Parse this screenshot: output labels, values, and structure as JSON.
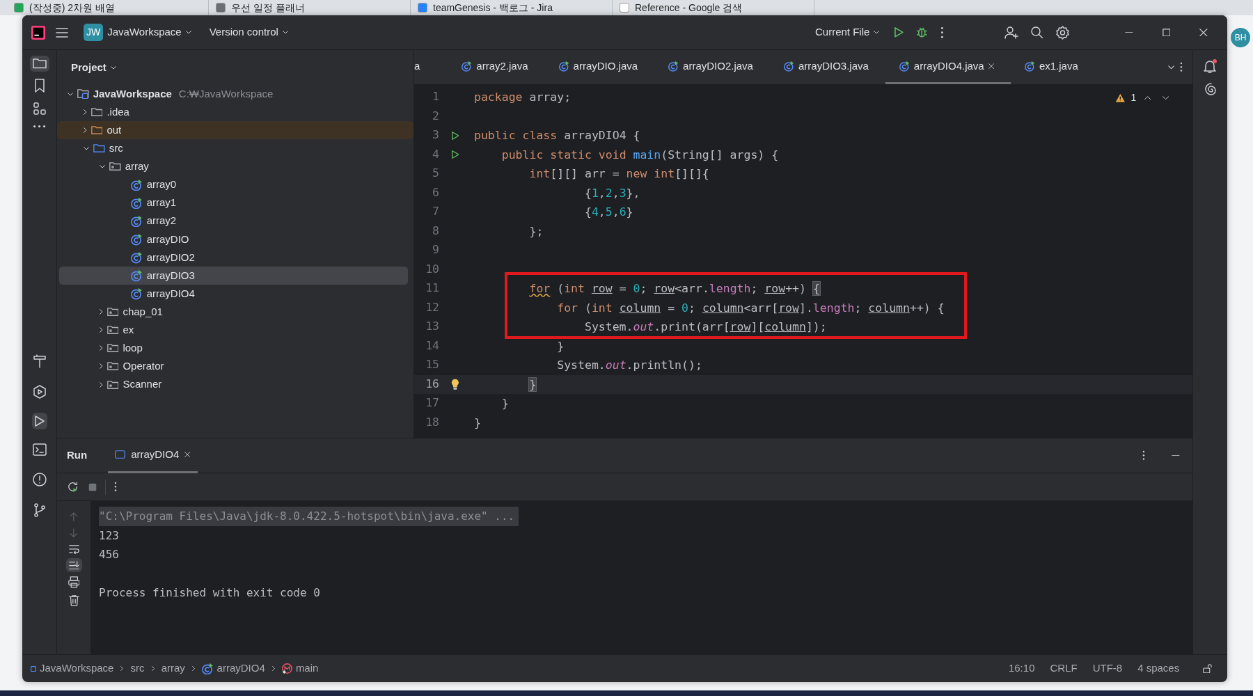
{
  "browser_tabs": [
    {
      "label": "(작성중) 2차원 배열",
      "selected": false
    },
    {
      "label": "우선 일정 플래너",
      "selected": false
    },
    {
      "label": "teamGenesis - 백로그 - Jira",
      "selected": false
    },
    {
      "label": "Reference - Google 검색",
      "selected": false
    }
  ],
  "title_bar": {
    "project_badge": "JW",
    "project": "JavaWorkspace",
    "vcs": "Version control",
    "run_config": "Current File",
    "avatar": "BH"
  },
  "project_panel": {
    "title": "Project",
    "tree": [
      {
        "label": "JavaWorkspace",
        "path": "C:₩JavaWorkspace",
        "kind": "module",
        "expanded": true,
        "selected": false,
        "children": [
          {
            "label": ".idea",
            "kind": "folder",
            "expanded": false,
            "selected": false
          },
          {
            "label": "out",
            "kind": "excluded",
            "expanded": false,
            "selected": false
          },
          {
            "label": "src",
            "kind": "source",
            "expanded": true,
            "selected": false,
            "children": [
              {
                "label": "array",
                "kind": "package",
                "expanded": true,
                "selected": false,
                "children": [
                  {
                    "label": "array0",
                    "kind": "class",
                    "selected": false
                  },
                  {
                    "label": "array1",
                    "kind": "class",
                    "selected": false
                  },
                  {
                    "label": "array2",
                    "kind": "class",
                    "selected": false
                  },
                  {
                    "label": "arrayDIO",
                    "kind": "class",
                    "selected": false
                  },
                  {
                    "label": "arrayDIO2",
                    "kind": "class",
                    "selected": false
                  },
                  {
                    "label": "arrayDIO3",
                    "kind": "class",
                    "selected": true
                  },
                  {
                    "label": "arrayDIO4",
                    "kind": "class",
                    "selected": false
                  }
                ]
              },
              {
                "label": "chap_01",
                "kind": "package",
                "expanded": false,
                "selected": false
              },
              {
                "label": "ex",
                "kind": "package",
                "expanded": false,
                "selected": false
              },
              {
                "label": "loop",
                "kind": "package",
                "expanded": false,
                "selected": false
              },
              {
                "label": "Operator",
                "kind": "package",
                "expanded": false,
                "selected": false
              },
              {
                "label": "Scanner",
                "kind": "package",
                "expanded": false,
                "selected": false
              }
            ]
          }
        ]
      }
    ]
  },
  "editor_tabs": [
    {
      "label": "a",
      "selected": false,
      "icon": false
    },
    {
      "label": "array2.java",
      "selected": false,
      "icon": true
    },
    {
      "label": "arrayDIO.java",
      "selected": false,
      "icon": true
    },
    {
      "label": "arrayDIO2.java",
      "selected": false,
      "icon": true
    },
    {
      "label": "arrayDIO3.java",
      "selected": false,
      "icon": true
    },
    {
      "label": "arrayDIO4.java",
      "selected": true,
      "icon": true
    },
    {
      "label": "ex1.java",
      "selected": false,
      "icon": true
    }
  ],
  "warnings": "1",
  "code_lines": [
    {
      "number": "1",
      "tokens": [
        {
          "kw": "package"
        },
        {
          "plain": " array;"
        }
      ]
    },
    {
      "number": "2"
    },
    {
      "number": "3",
      "run_icon": true,
      "tokens": [
        {
          "kw": "public class"
        },
        {
          "plain": " arrayDIO4 {"
        }
      ]
    },
    {
      "number": "4",
      "run_icon": true,
      "tokens": [
        {
          "kw": "    public static void "
        },
        {
          "fn": "main"
        },
        {
          "plain": "(String[] args) {"
        }
      ]
    },
    {
      "number": "5",
      "tokens": [
        {
          "kw": "        int"
        },
        {
          "plain": "[][] arr = "
        },
        {
          "kw": "new int"
        },
        {
          "plain": "[][]{"
        }
      ]
    },
    {
      "number": "6",
      "tokens": [
        {
          "plain": "                {"
        },
        {
          "num": "1"
        },
        {
          "plain": ","
        },
        {
          "num": "2"
        },
        {
          "plain": ","
        },
        {
          "num": "3"
        },
        {
          "plain": "},"
        }
      ]
    },
    {
      "number": "7",
      "tokens": [
        {
          "plain": "                {"
        },
        {
          "num": "4"
        },
        {
          "plain": ","
        },
        {
          "num": "5"
        },
        {
          "plain": ","
        },
        {
          "num": "6"
        },
        {
          "plain": "}"
        }
      ]
    },
    {
      "number": "8",
      "tokens": [
        {
          "plain": "        };"
        }
      ]
    },
    {
      "number": "9"
    },
    {
      "number": "10"
    },
    {
      "number": "11",
      "boxed": true,
      "tokens": [
        {
          "kw_warn": "        for"
        },
        {
          "plain": " ("
        },
        {
          "kw": "int "
        },
        {
          "var": "row"
        },
        {
          "plain": " = "
        },
        {
          "num": "0"
        },
        {
          "plain": "; "
        },
        {
          "var": "row"
        },
        {
          "plain": "<arr."
        },
        {
          "member": "length"
        },
        {
          "plain": "; "
        },
        {
          "var": "row"
        },
        {
          "plain": "++) "
        },
        {
          "brace": "{"
        }
      ]
    },
    {
      "number": "12",
      "boxed": true,
      "tokens": [
        {
          "kw": "            for"
        },
        {
          "plain": " ("
        },
        {
          "kw": "int "
        },
        {
          "var": "column"
        },
        {
          "plain": " = "
        },
        {
          "num": "0"
        },
        {
          "plain": "; "
        },
        {
          "var": "column"
        },
        {
          "plain": "<arr["
        },
        {
          "var": "row"
        },
        {
          "plain": "]."
        },
        {
          "member": "length"
        },
        {
          "plain": "; "
        },
        {
          "var": "column"
        },
        {
          "plain": "++) {"
        }
      ]
    },
    {
      "number": "13",
      "boxed": true,
      "tokens": [
        {
          "plain": "                System."
        },
        {
          "field": "out"
        },
        {
          "plain": ".print(arr["
        },
        {
          "var": "row"
        },
        {
          "plain": "]["
        },
        {
          "var": "column"
        },
        {
          "plain": "]);"
        }
      ]
    },
    {
      "number": "14",
      "tokens": [
        {
          "plain": "            }"
        }
      ]
    },
    {
      "number": "15",
      "tokens": [
        {
          "plain": "            System."
        },
        {
          "field": "out"
        },
        {
          "plain": ".println();"
        }
      ]
    },
    {
      "number": "16",
      "current": true,
      "bulb": true,
      "tokens": [
        {
          "brace": "        }"
        }
      ]
    },
    {
      "number": "17",
      "tokens": [
        {
          "plain": "    }"
        }
      ]
    },
    {
      "number": "18",
      "tokens": [
        {
          "plain": "}"
        }
      ]
    }
  ],
  "run_panel": {
    "title": "Run",
    "tab": "arrayDIO4",
    "console": [
      {
        "text": "\"C:\\Program Files\\Java\\jdk-8.0.422.5-hotspot\\bin\\java.exe\" ...",
        "kind": "command"
      },
      {
        "text": "123",
        "kind": "output"
      },
      {
        "text": "456",
        "kind": "output"
      },
      {
        "text": "Process finished with exit code 0",
        "kind": "exit"
      }
    ]
  },
  "breadcrumbs": [
    {
      "label": "JavaWorkspace",
      "kind": "module"
    },
    {
      "label": "src",
      "kind": "folder"
    },
    {
      "label": "array",
      "kind": "folder"
    },
    {
      "label": "arrayDIO4",
      "kind": "class"
    },
    {
      "label": "main",
      "kind": "method"
    }
  ],
  "status_bar": [
    "16:10",
    "CRLF",
    "UTF-8",
    "4 spaces"
  ]
}
